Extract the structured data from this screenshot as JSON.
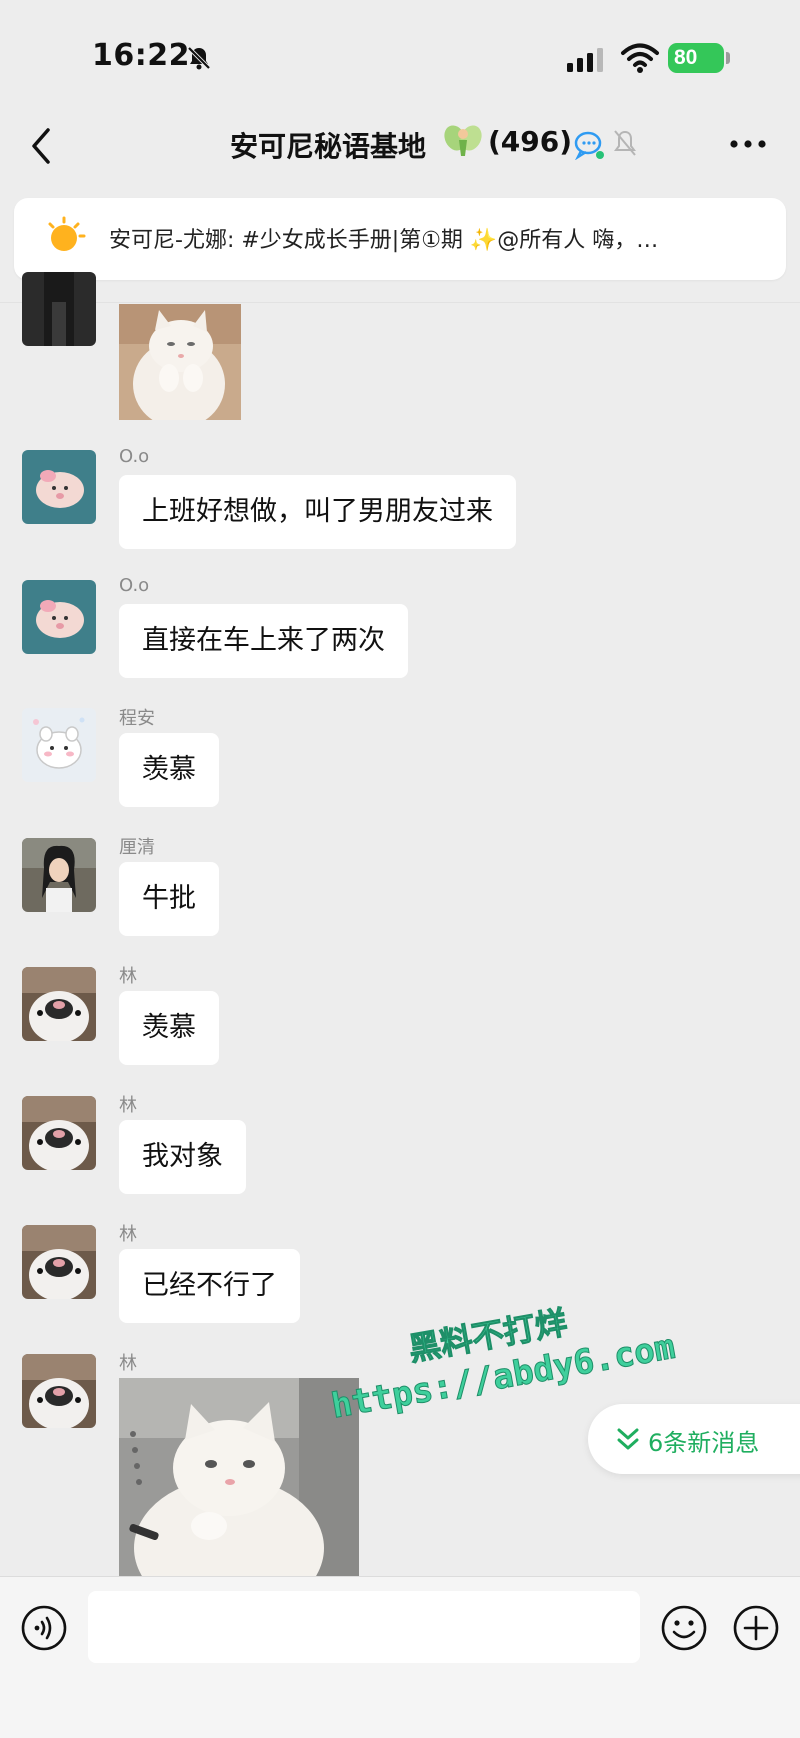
{
  "status_bar": {
    "time": "16:22",
    "battery": "80",
    "icons": [
      "bell-slash-icon",
      "cellular-signal-icon",
      "wifi-icon",
      "battery-charging-icon"
    ]
  },
  "nav": {
    "back_icon": "chevron-left-icon",
    "title": "安可尼秘语基地",
    "title_emoji": "fairy-emoji",
    "member_count": "(496)",
    "icons": [
      "chat-bubble-icon",
      "bell-off-icon",
      "more-icon"
    ]
  },
  "announcement": {
    "icon": "sun-icon",
    "text": "安可尼-尤娜: #少女成长手册|第①期 ✨@所有人  嗨，…"
  },
  "messages": [
    {
      "type": "image",
      "sender": "",
      "avatar": "dark-photo-avatar",
      "content": "cat-sticker"
    },
    {
      "type": "text",
      "sender": "O.o",
      "avatar": "pink-plush-avatar",
      "content": "上班好想做，叫了男朋友过来"
    },
    {
      "type": "text",
      "sender": "O.o",
      "avatar": "pink-plush-avatar",
      "content": "直接在车上来了两次"
    },
    {
      "type": "text",
      "sender": "程安",
      "avatar": "cartoon-bear-avatar",
      "content": "羡慕"
    },
    {
      "type": "text",
      "sender": "厘清",
      "avatar": "girl-photo-avatar",
      "content": "牛批"
    },
    {
      "type": "text",
      "sender": "林",
      "avatar": "cat-closeup-avatar",
      "content": "羡慕"
    },
    {
      "type": "text",
      "sender": "林",
      "avatar": "cat-closeup-avatar",
      "content": "我对象"
    },
    {
      "type": "text",
      "sender": "林",
      "avatar": "cat-closeup-avatar",
      "content": "已经不行了"
    },
    {
      "type": "image",
      "sender": "林",
      "avatar": "cat-closeup-avatar",
      "content": "cat-sticker"
    }
  ],
  "watermark": {
    "line1": "黑料不打烊",
    "line2": "https://abdy6.com"
  },
  "new_messages_pill": {
    "icon": "double-chevron-down-icon",
    "label": "6条新消息"
  },
  "input_bar": {
    "placeholder": "",
    "icons": [
      "voice-icon",
      "emoji-icon",
      "plus-icon"
    ]
  },
  "colors": {
    "background": "#ededed",
    "bubble": "#ffffff",
    "accent_green": "#1fae5f",
    "battery_green": "#34c759"
  }
}
